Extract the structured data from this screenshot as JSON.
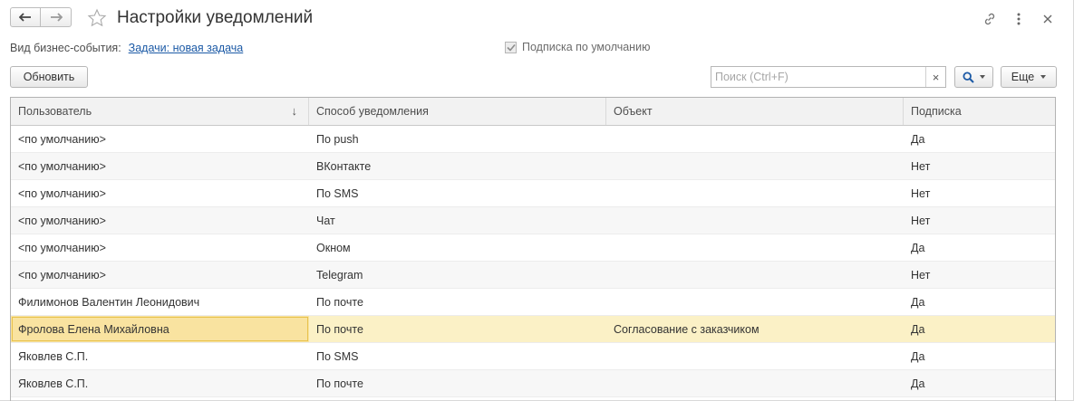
{
  "window": {
    "title": "Настройки уведомлений",
    "back_icon": "arrow-left-icon",
    "forward_icon": "arrow-right-icon",
    "favorite_icon": "star-icon",
    "link_icon": "link-icon",
    "menu_icon": "more-vertical-icon",
    "close_icon": "close-icon"
  },
  "event": {
    "label": "Вид бизнес-события:",
    "value": "Задачи: новая задача"
  },
  "default_subscription": {
    "label": "Подписка по умолчанию",
    "checked": true
  },
  "toolbar": {
    "refresh_label": "Обновить",
    "search_placeholder": "Поиск (Ctrl+F)",
    "clear_label": "×",
    "more_label": "Еще"
  },
  "table": {
    "columns": [
      "Пользователь",
      "Способ уведомления",
      "Объект",
      "Подписка"
    ],
    "sort_indicator": "↓",
    "rows": [
      {
        "user": "<по умолчанию>",
        "method": "По push",
        "object": "",
        "subscription": "Да"
      },
      {
        "user": "<по умолчанию>",
        "method": "ВКонтакте",
        "object": "",
        "subscription": "Нет"
      },
      {
        "user": "<по умолчанию>",
        "method": "По SMS",
        "object": "",
        "subscription": "Нет"
      },
      {
        "user": "<по умолчанию>",
        "method": "Чат",
        "object": "",
        "subscription": "Нет"
      },
      {
        "user": "<по умолчанию>",
        "method": "Окном",
        "object": "",
        "subscription": "Да"
      },
      {
        "user": "<по умолчанию>",
        "method": "Telegram",
        "object": "",
        "subscription": "Нет"
      },
      {
        "user": "Филимонов Валентин Леонидович",
        "method": "По почте",
        "object": "",
        "subscription": "Да"
      },
      {
        "user": "Фролова Елена Михайловна",
        "method": "По почте",
        "object": "Согласование с заказчиком",
        "subscription": "Да",
        "selected": true
      },
      {
        "user": "Яковлев С.П.",
        "method": "По SMS",
        "object": "",
        "subscription": "Да"
      },
      {
        "user": "Яковлев С.П.",
        "method": "По почте",
        "object": "",
        "subscription": "Да"
      }
    ]
  },
  "colors": {
    "link": "#1c5aa6",
    "selected_row": "#fbf1c6",
    "selected_cell": "#f9e3a0"
  }
}
